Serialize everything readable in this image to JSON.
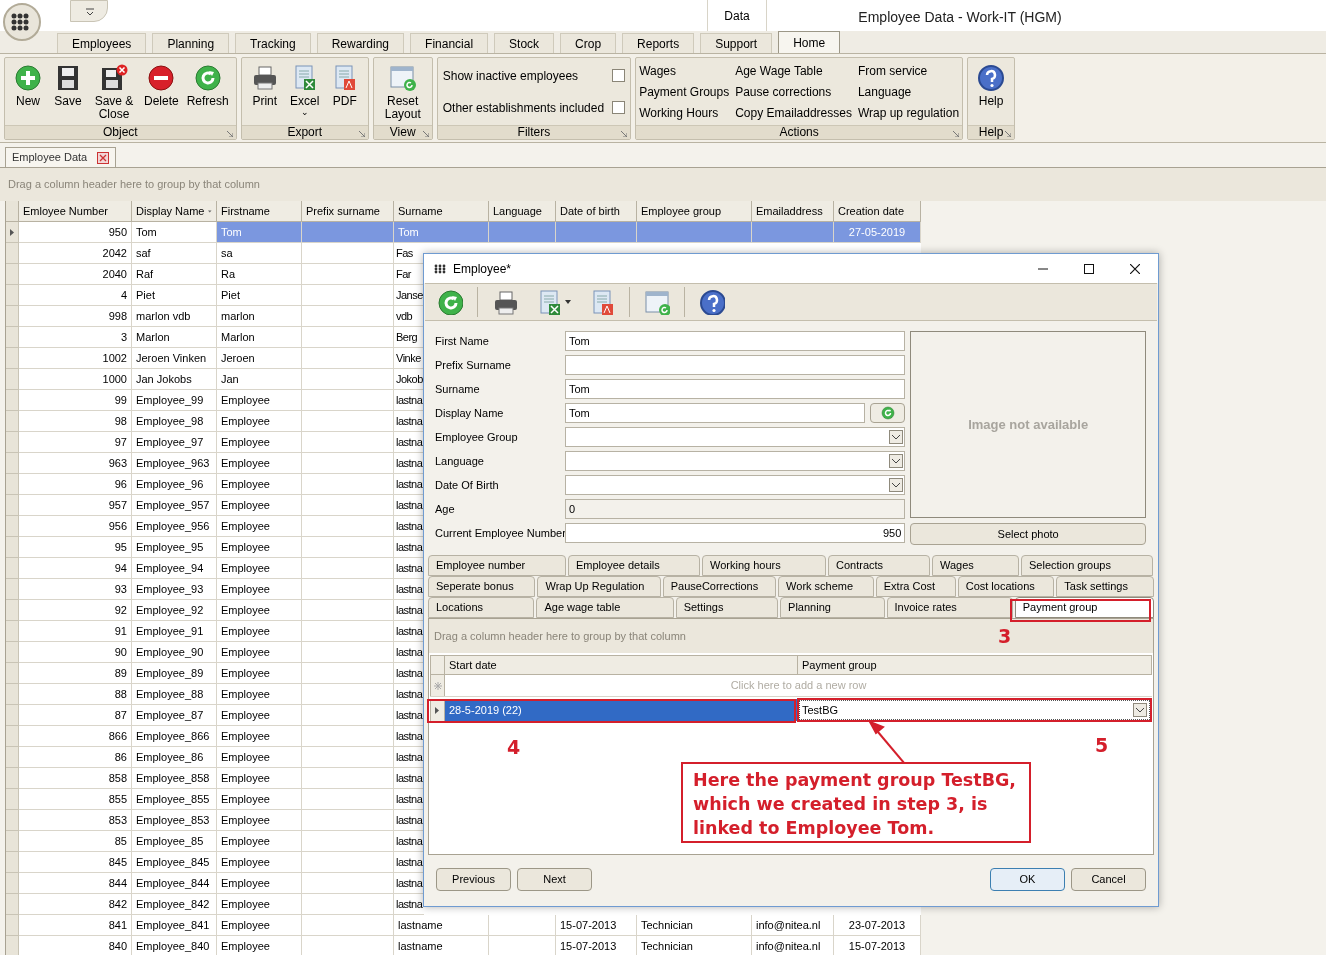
{
  "window": {
    "title": "Employee Data - Work-IT (HGM)",
    "context_tab": "Data"
  },
  "ribbon_tabs": [
    {
      "label": "Employees",
      "selected": false
    },
    {
      "label": "Planning",
      "selected": false
    },
    {
      "label": "Tracking",
      "selected": false
    },
    {
      "label": "Rewarding",
      "selected": false
    },
    {
      "label": "Financial",
      "selected": false
    },
    {
      "label": "Stock",
      "selected": false
    },
    {
      "label": "Crop",
      "selected": false
    },
    {
      "label": "Reports",
      "selected": false
    },
    {
      "label": "Support",
      "selected": false
    },
    {
      "label": "Home",
      "selected": true
    }
  ],
  "ribbon_groups": [
    {
      "label": "Object",
      "kind": "buttons",
      "buttons": [
        {
          "label": "New"
        },
        {
          "label": "Save"
        },
        {
          "label": "Save & Close"
        },
        {
          "label": "Delete"
        },
        {
          "label": "Refresh"
        }
      ]
    },
    {
      "label": "Export",
      "kind": "buttons",
      "buttons": [
        {
          "label": "Print"
        },
        {
          "label": "Excel",
          "caret": "⌄"
        },
        {
          "label": "PDF"
        }
      ]
    },
    {
      "label": "View",
      "kind": "buttons",
      "buttons": [
        {
          "label": "Reset Layout"
        }
      ]
    },
    {
      "label": "Filters",
      "kind": "checkboxes",
      "options": [
        {
          "label": "Show inactive employees",
          "checked": false
        },
        {
          "label": "Other establishments included",
          "checked": false
        }
      ]
    },
    {
      "label": "Actions",
      "kind": "links",
      "links": [
        "Wages",
        "Payment Groups",
        "Working Hours",
        "Age Wage Table",
        "Pause corrections",
        "Copy Emailaddresses",
        "From service",
        "Language",
        "Wrap up regulation"
      ]
    },
    {
      "label": "Help",
      "kind": "buttons",
      "buttons": [
        {
          "label": "Help"
        }
      ]
    }
  ],
  "document_tab": {
    "label": "Employee Data"
  },
  "group_panel": "Drag a column header here to group by that column",
  "grid": {
    "columns": [
      "Emloyee Number",
      "Display Name",
      "Firstname",
      "Prefix surname",
      "Surname",
      "Language",
      "Date of birth",
      "Employee group",
      "Emailaddress",
      "Creation date"
    ],
    "rows": [
      {
        "selected": true,
        "number": "950",
        "display_name": "Tom",
        "firstname": "Tom",
        "surname": "Tom",
        "created": "27-05-2019"
      },
      {
        "selected": false,
        "number": "2042",
        "display_name": "saf",
        "firstname": "sa",
        "surname": "Fas"
      },
      {
        "selected": false,
        "number": "2040",
        "display_name": "Raf",
        "firstname": "Ra",
        "surname": "Far"
      },
      {
        "selected": false,
        "number": "4",
        "display_name": "Piet",
        "firstname": "Piet",
        "surname": "Janse"
      },
      {
        "selected": false,
        "number": "998",
        "display_name": "marlon vdb",
        "firstname": "marlon",
        "surname": "vdb"
      },
      {
        "selected": false,
        "number": "3",
        "display_name": "Marlon",
        "firstname": "Marlon",
        "surname": "Berg"
      },
      {
        "selected": false,
        "number": "1002",
        "display_name": "Jeroen Vinken",
        "firstname": "Jeroen",
        "surname": "Vinke"
      },
      {
        "selected": false,
        "number": "1000",
        "display_name": "Jan Jokobs",
        "firstname": "Jan",
        "surname": "Jokob"
      },
      {
        "selected": false,
        "number": "99",
        "display_name": "Employee_99",
        "firstname": "Employee",
        "surname": "lastna"
      },
      {
        "selected": false,
        "number": "98",
        "display_name": "Employee_98",
        "firstname": "Employee",
        "surname": "lastna"
      },
      {
        "selected": false,
        "number": "97",
        "display_name": "Employee_97",
        "firstname": "Employee",
        "surname": "lastna"
      },
      {
        "selected": false,
        "number": "963",
        "display_name": "Employee_963",
        "firstname": "Employee",
        "surname": "lastna"
      },
      {
        "selected": false,
        "number": "96",
        "display_name": "Employee_96",
        "firstname": "Employee",
        "surname": "lastna"
      },
      {
        "selected": false,
        "number": "957",
        "display_name": "Employee_957",
        "firstname": "Employee",
        "surname": "lastna"
      },
      {
        "selected": false,
        "number": "956",
        "display_name": "Employee_956",
        "firstname": "Employee",
        "surname": "lastna"
      },
      {
        "selected": false,
        "number": "95",
        "display_name": "Employee_95",
        "firstname": "Employee",
        "surname": "lastna"
      },
      {
        "selected": false,
        "number": "94",
        "display_name": "Employee_94",
        "firstname": "Employee",
        "surname": "lastna"
      },
      {
        "selected": false,
        "number": "93",
        "display_name": "Employee_93",
        "firstname": "Employee",
        "surname": "lastna"
      },
      {
        "selected": false,
        "number": "92",
        "display_name": "Employee_92",
        "firstname": "Employee",
        "surname": "lastna"
      },
      {
        "selected": false,
        "number": "91",
        "display_name": "Employee_91",
        "firstname": "Employee",
        "surname": "lastna"
      },
      {
        "selected": false,
        "number": "90",
        "display_name": "Employee_90",
        "firstname": "Employee",
        "surname": "lastna"
      },
      {
        "selected": false,
        "number": "89",
        "display_name": "Employee_89",
        "firstname": "Employee",
        "surname": "lastna"
      },
      {
        "selected": false,
        "number": "88",
        "display_name": "Employee_88",
        "firstname": "Employee",
        "surname": "lastna"
      },
      {
        "selected": false,
        "number": "87",
        "display_name": "Employee_87",
        "firstname": "Employee",
        "surname": "lastna"
      },
      {
        "selected": false,
        "number": "866",
        "display_name": "Employee_866",
        "firstname": "Employee",
        "surname": "lastna"
      },
      {
        "selected": false,
        "number": "86",
        "display_name": "Employee_86",
        "firstname": "Employee",
        "surname": "lastna"
      },
      {
        "selected": false,
        "number": "858",
        "display_name": "Employee_858",
        "firstname": "Employee",
        "surname": "lastna"
      },
      {
        "selected": false,
        "number": "855",
        "display_name": "Employee_855",
        "firstname": "Employee",
        "surname": "lastna"
      },
      {
        "selected": false,
        "number": "853",
        "display_name": "Employee_853",
        "firstname": "Employee",
        "surname": "lastna"
      },
      {
        "selected": false,
        "number": "85",
        "display_name": "Employee_85",
        "firstname": "Employee",
        "surname": "lastna"
      },
      {
        "selected": false,
        "number": "845",
        "display_name": "Employee_845",
        "firstname": "Employee",
        "surname": "lastna"
      },
      {
        "selected": false,
        "number": "844",
        "display_name": "Employee_844",
        "firstname": "Employee",
        "surname": "lastna"
      },
      {
        "selected": false,
        "number": "842",
        "display_name": "Employee_842",
        "firstname": "Employee",
        "surname": "lastna"
      },
      {
        "selected": false,
        "number": "841",
        "display_name": "Employee_841",
        "firstname": "Employee",
        "surname": "lastname",
        "dob": "15-07-2013",
        "group": "Technician",
        "email": "info@nitea.nl",
        "created": "23-07-2013"
      },
      {
        "selected": false,
        "number": "840",
        "display_name": "Employee_840",
        "firstname": "Employee",
        "surname": "lastname",
        "dob": "15-07-2013",
        "group": "Technician",
        "email": "info@nitea.nl",
        "created": "15-07-2013"
      }
    ]
  },
  "dialog": {
    "title": "Employee*",
    "fields": [
      {
        "label": "First Name",
        "kind": "text",
        "value": "Tom"
      },
      {
        "label": "Prefix Surname",
        "kind": "text"
      },
      {
        "label": "Surname",
        "kind": "text",
        "value": "Tom"
      },
      {
        "label": "Display Name",
        "kind": "text_button",
        "value": "Tom"
      },
      {
        "label": "Employee Group",
        "kind": "dropdown"
      },
      {
        "label": "Language",
        "kind": "dropdown"
      },
      {
        "label": "Date Of Birth",
        "kind": "dropdown"
      },
      {
        "label": "Age",
        "kind": "readonly",
        "value": "0"
      },
      {
        "label": "Current Employee Number",
        "kind": "number",
        "value": "950"
      }
    ],
    "photo": {
      "placeholder_text": "Image not available",
      "button": "Select photo"
    },
    "tab_rows": [
      [
        {
          "label": "Employee number",
          "selected": false
        },
        {
          "label": "Employee details",
          "selected": false
        },
        {
          "label": "Working hours",
          "selected": false
        },
        {
          "label": "Contracts",
          "selected": false
        },
        {
          "label": "Wages",
          "selected": false
        },
        {
          "label": "Selection groups",
          "selected": false
        }
      ],
      [
        {
          "label": "Seperate bonus",
          "selected": false
        },
        {
          "label": "Wrap Up Regulation",
          "selected": false
        },
        {
          "label": "PauseCorrections",
          "selected": false
        },
        {
          "label": "Work scheme",
          "selected": false
        },
        {
          "label": "Extra Cost",
          "selected": false
        },
        {
          "label": "Cost locations",
          "selected": false
        },
        {
          "label": "Task settings",
          "selected": false
        }
      ],
      [
        {
          "label": "Locations",
          "selected": false
        },
        {
          "label": "Age wage table",
          "selected": false
        },
        {
          "label": "Settings",
          "selected": false
        },
        {
          "label": "Planning",
          "selected": false
        },
        {
          "label": "Invoice rates",
          "selected": false
        },
        {
          "label": "Payment group",
          "selected": true
        }
      ]
    ],
    "group_panel": "Drag a column header here to group by that column",
    "grid": {
      "columns": [
        "Start date",
        "Payment group"
      ],
      "new_row": "Click here to add a new row",
      "rows": [
        {
          "start_date": "28-5-2019 (22)",
          "payment_group": "TestBG",
          "selected": true
        }
      ]
    },
    "buttons_left": [
      "Previous",
      "Next"
    ],
    "buttons_right": [
      {
        "label": "OK",
        "focused": true
      },
      {
        "label": "Cancel",
        "focused": false
      }
    ]
  },
  "annotations": {
    "markers": [
      "3",
      "4",
      "5"
    ],
    "callout": "Here the payment group TestBG, which we created in step 3, is linked to Employee Tom."
  }
}
